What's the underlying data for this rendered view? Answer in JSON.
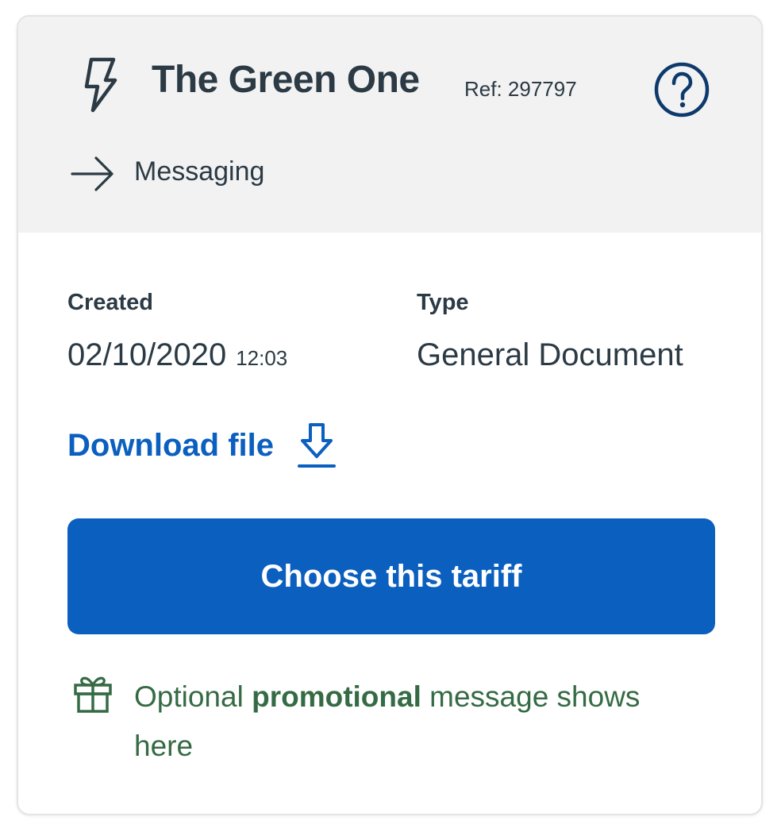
{
  "card": {
    "title": "The Green One",
    "ref": "Ref: 297797",
    "category": "Messaging",
    "icons": {
      "tariff": "lightning-bolt-icon",
      "help": "question-circle-icon",
      "category": "arrow-right-icon",
      "download": "download-arrow-icon",
      "promo": "gift-icon"
    }
  },
  "details": {
    "created_label": "Created",
    "created_date": "02/10/2020",
    "created_time": "12:03",
    "type_label": "Type",
    "type_value": "General Document"
  },
  "download": {
    "label": "Download file"
  },
  "cta": {
    "label": "Choose this tariff"
  },
  "promo": {
    "prefix": "Optional ",
    "highlight": "promotional",
    "suffix": " message shows here"
  },
  "colors": {
    "primary": "#0b5fbf",
    "text": "#2b3a44",
    "promo": "#356b44",
    "header_bg": "#f2f2f2",
    "help_ring": "#0e3a6b"
  }
}
